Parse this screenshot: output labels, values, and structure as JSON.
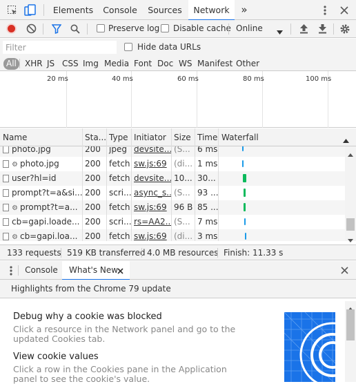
{
  "tabs": [
    "Elements",
    "Console",
    "Sources",
    "Network"
  ],
  "active_tab": "Network",
  "more_tabs_glyph": "»",
  "toolbar": {
    "preserve_log": "Preserve log",
    "disable_cache": "Disable cache",
    "throttle_value": "Online"
  },
  "filter": {
    "placeholder": "Filter",
    "hide_data_urls": "Hide data URLs"
  },
  "type_filters": [
    "All",
    "XHR",
    "JS",
    "CSS",
    "Img",
    "Media",
    "Font",
    "Doc",
    "WS",
    "Manifest",
    "Other"
  ],
  "overview_ticks": [
    "20 ms",
    "40 ms",
    "60 ms",
    "80 ms",
    "100 ms"
  ],
  "columns": [
    "Name",
    "Sta...",
    "Type",
    "Initiator",
    "Size",
    "Time",
    "Waterfall"
  ],
  "rows": [
    {
      "name": "photo.jpg",
      "status": "200",
      "type": "jpeg",
      "initiator": "devsite...",
      "size": "(S...",
      "time": "6 ms",
      "gear": false
    },
    {
      "name": "photo.jpg",
      "status": "200",
      "type": "fetch",
      "initiator": "sw.js:69",
      "size": "(di...",
      "time": "1 ms",
      "gear": true
    },
    {
      "name": "user?hl=id",
      "status": "200",
      "type": "fetch",
      "initiator": "devsite...",
      "size": "10...",
      "time": "30...",
      "gear": false
    },
    {
      "name": "prompt?t=a&si...",
      "status": "200",
      "type": "scri...",
      "initiator": "async_s...",
      "size": "(S...",
      "time": "93 ...",
      "gear": false
    },
    {
      "name": "prompt?t=a...",
      "status": "200",
      "type": "fetch",
      "initiator": "sw.js:69",
      "size": "96 B",
      "time": "85 ...",
      "gear": true
    },
    {
      "name": "cb=gapi.loade...",
      "status": "200",
      "type": "scri...",
      "initiator": "rs=AA2...",
      "size": "(S...",
      "time": "7 ms",
      "gear": false
    },
    {
      "name": "cb=gapi.loa...",
      "status": "200",
      "type": "fetch",
      "initiator": "sw.js:69",
      "size": "(di...",
      "time": "3 ms",
      "gear": true
    }
  ],
  "status_bar": {
    "requests": "133 requests",
    "transferred": "519 KB transferred",
    "resources": "4.0 MB resources",
    "finish": "Finish: 11.33 s"
  },
  "drawer": {
    "tabs": [
      "Console",
      "What's New"
    ],
    "active": "What's New",
    "highlights": "Highlights from the Chrome 79 update",
    "items": [
      {
        "title": "Debug why a cookie was blocked",
        "desc": "Click a resource in the Network panel and go to the updated Cookies tab."
      },
      {
        "title": "View cookie values",
        "desc": "Click a row in the Cookies pane in the Application panel to see the cookie's value."
      }
    ]
  },
  "colors": {
    "accent": "#1a73e8",
    "record": "#d93025",
    "waterfall_blue": "#1a9ae8",
    "waterfall_green": "#0cba5c"
  }
}
